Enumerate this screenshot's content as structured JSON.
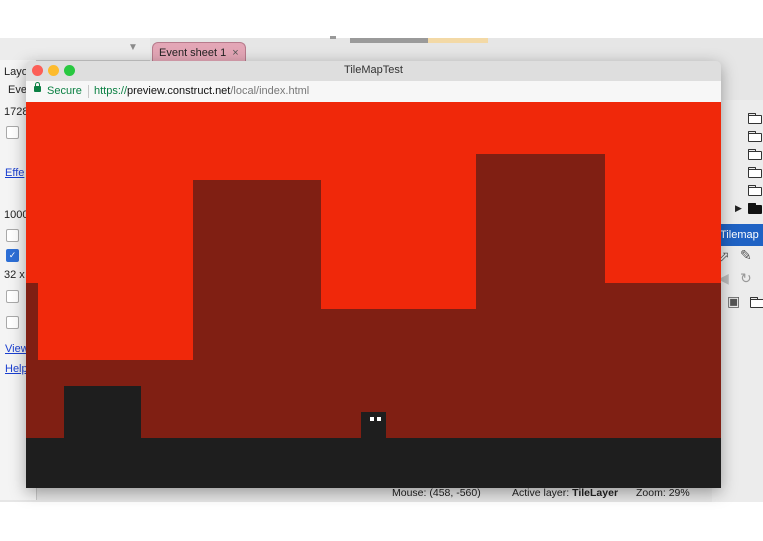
{
  "editor": {
    "event_tab_label": "Event sheet 1",
    "event_tab_close": "×",
    "props_tab_layout": "Layo",
    "props_tab_events": "Eve",
    "prop_value_1": "1728",
    "effects_link": "Effe",
    "prop_value_2": "1000",
    "prop_value_3": "32 x",
    "view_link": "View",
    "help_link": "Help",
    "tilemap_tab": "Tilemap",
    "status": {
      "mouse_label": "Mouse:",
      "mouse_value": "(458, -560)",
      "layer_label": "Active layer:",
      "layer_value": "TileLayer",
      "zoom_label": "Zoom:",
      "zoom_value": "29%"
    }
  },
  "browser": {
    "title": "TileMapTest",
    "secure_label": "Secure",
    "url_scheme": "https://",
    "url_host": "preview.construct.net",
    "url_path": "/local/index.html"
  },
  "colors": {
    "sky": "#f0280a",
    "ground": "#801f13",
    "solid": "#1e1e1e",
    "accent": "#1f62c4"
  },
  "icons": [
    "folder-icon",
    "expand-arrow-icon",
    "select-arrow-icon",
    "pencil-icon",
    "undo-icon",
    "redo-icon",
    "save-icon",
    "open-folder-icon",
    "lock-icon"
  ]
}
